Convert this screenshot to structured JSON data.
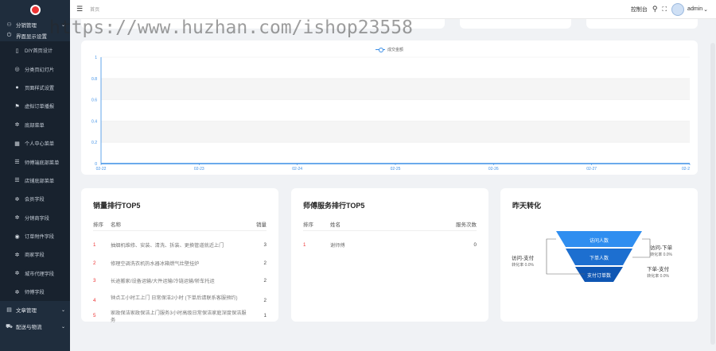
{
  "sidebar": {
    "group_top": "分销管理",
    "group_display": "界面显示设置",
    "items": [
      {
        "icon": "mobile-icon",
        "glyph": "▯",
        "label": "DIY首页设计"
      },
      {
        "icon": "slideshow-icon",
        "glyph": "◎",
        "label": "分类页幻灯片"
      },
      {
        "icon": "user-icon",
        "glyph": "●",
        "label": "页面样式设置"
      },
      {
        "icon": "flag-icon",
        "glyph": "⚑",
        "label": "虚拟订单播报"
      },
      {
        "icon": "gear-icon",
        "glyph": "✲",
        "label": "底部菜单"
      },
      {
        "icon": "grid-icon",
        "glyph": "▦",
        "label": "个人中心菜单"
      },
      {
        "icon": "sliders-icon",
        "glyph": "☰",
        "label": "师傅端底部菜单"
      },
      {
        "icon": "sliders-icon",
        "glyph": "☰",
        "label": "店铺底部菜单"
      },
      {
        "icon": "gear-icon",
        "glyph": "✲",
        "label": "会员字段"
      },
      {
        "icon": "gear-icon",
        "glyph": "✲",
        "label": "分销商字段"
      },
      {
        "icon": "order-icon",
        "glyph": "◉",
        "label": "订单附件字段"
      },
      {
        "icon": "gear-icon",
        "glyph": "✲",
        "label": "商家字段"
      },
      {
        "icon": "gear-icon",
        "glyph": "✲",
        "label": "城市代理字段"
      },
      {
        "icon": "gear-icon",
        "glyph": "✲",
        "label": "师傅字段"
      }
    ],
    "group_article": "文章管理",
    "group_delivery": "配送与物流"
  },
  "header": {
    "breadcrumb": "首页",
    "console": "控制台",
    "user": "admin"
  },
  "watermark": "https://www.huzhan.com/ishop23558",
  "chart_data": {
    "type": "line",
    "series": [
      {
        "name": "成交金额",
        "values": [
          0,
          0,
          0,
          0,
          0,
          0,
          0
        ]
      }
    ],
    "categories": [
      "02-22",
      "02-23",
      "02-24",
      "02-25",
      "02-26",
      "02-27",
      "02-2"
    ],
    "yticks": [
      "0",
      "0.2",
      "0.4",
      "0.6",
      "0.8",
      "1"
    ],
    "ylim": [
      0,
      1
    ],
    "color": "#3a8ee6"
  },
  "sales": {
    "title": "销量排行TOP5",
    "col_rank": "排序",
    "col_name": "名称",
    "col_qty": "销量",
    "rows": [
      {
        "rank": "1",
        "name": "抽烟机维修、安装、清洗、拆装、更换管道就近上门",
        "qty": "3"
      },
      {
        "rank": "2",
        "name": "修理空调洗衣机热水器冰箱燃气灶壁挂炉",
        "qty": "2"
      },
      {
        "rank": "3",
        "name": "长途搬家/设备运输/大件运输/冷链运输/轿车托运",
        "qty": "2"
      },
      {
        "rank": "4",
        "name": "钟点工小时工上门 日常保洁2小时 (下单后请联系客服预约)",
        "qty": "2"
      },
      {
        "rank": "5",
        "name": "家政保洁家政保洁上门服务3小时高级日常保洁家庭深度保洁服务",
        "qty": "1"
      }
    ]
  },
  "service": {
    "title": "师傅服务排行TOP5",
    "col_rank": "排序",
    "col_name": "姓名",
    "col_count": "服务次数",
    "rows": [
      {
        "rank": "1",
        "name": "谢师傅",
        "count": "0"
      }
    ]
  },
  "conversion": {
    "title": "昨天转化",
    "funnel": [
      {
        "label": "访问人数",
        "color": "#2f8ef0"
      },
      {
        "label": "下单人数",
        "color": "#1d6fd0"
      },
      {
        "label": "支付订单数",
        "color": "#0f56b3"
      }
    ],
    "left_label": "访问-支付",
    "left_rate": "转化率 0.0%",
    "right_top_label": "访问-下单",
    "right_top_rate": "转化率 0.0%",
    "right_bottom_label": "下单-支付",
    "right_bottom_rate": "转化率 0.0%"
  }
}
